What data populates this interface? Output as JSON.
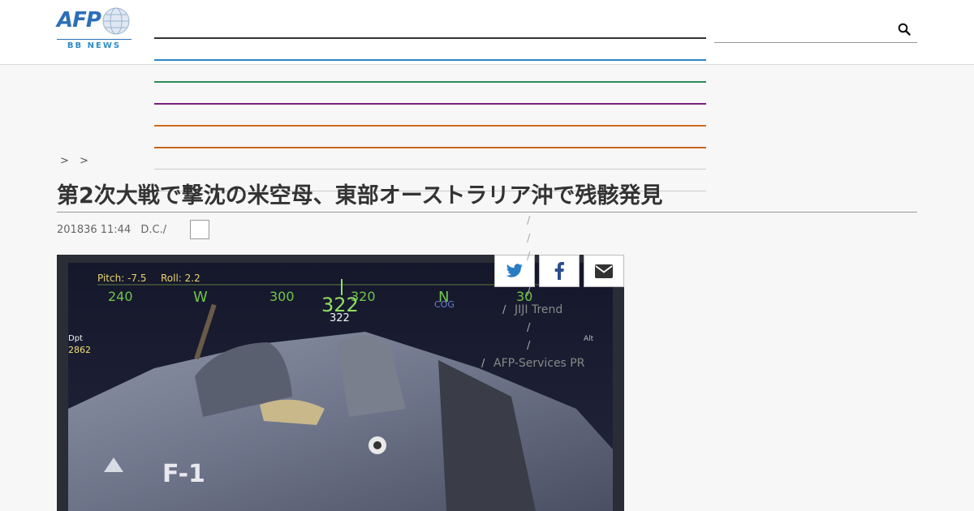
{
  "header": {
    "logo": {
      "brand": "AFP",
      "subtitle": "BB NEWS"
    },
    "nav_colors": [
      "#333333",
      "#2e86c1",
      "#2e8b57",
      "#7b1f7f",
      "#d2691e",
      "#c8641e",
      "#cccccc",
      "#cccccc"
    ],
    "search_icon": "search-icon"
  },
  "breadcrumb": {
    "separators": [
      ">",
      ">"
    ]
  },
  "article": {
    "title": "第2次大戦で撃沈の米空母、東部オーストラリア沖で残骸発見",
    "date": "201836 11:44",
    "location": "D.C./"
  },
  "share": {
    "icons": [
      "twitter-icon",
      "facebook-icon",
      "email-icon"
    ]
  },
  "sidebar": {
    "links": [
      "JIJI Trend",
      "AFP-Services PR"
    ],
    "slash": "/"
  },
  "photo": {
    "pitch": "Pitch: -7.5",
    "roll": "Roll: 2.2",
    "compass": [
      "240",
      "W",
      "300",
      "320",
      "N",
      "30"
    ],
    "cog": "COG",
    "heading_big": "322",
    "heading_small": "322",
    "depth_label": "Dpt",
    "depth_value": "2862",
    "alt_label": "Alt"
  }
}
